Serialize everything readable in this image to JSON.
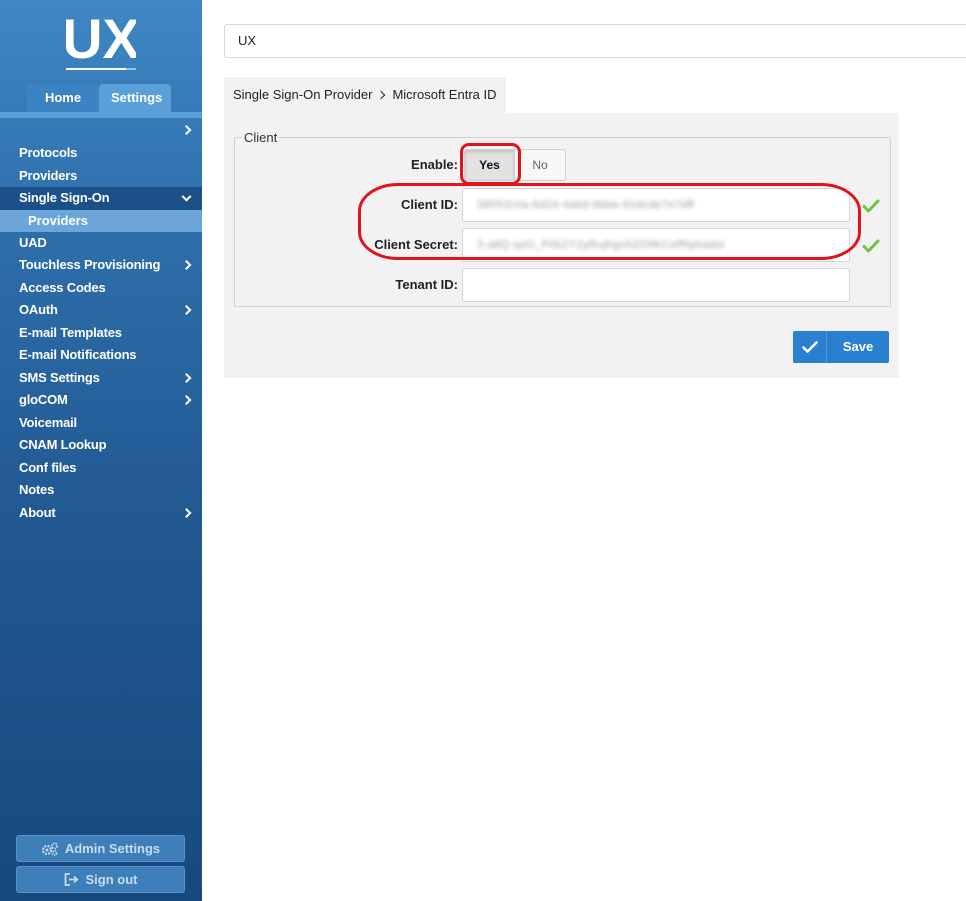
{
  "sidebar": {
    "logo_text": "UX",
    "tabs": [
      {
        "label": "Home"
      },
      {
        "label": "Settings"
      }
    ],
    "items": [
      {
        "label": "Protocols"
      },
      {
        "label": "Providers"
      },
      {
        "label": "Single Sign-On"
      },
      {
        "label": "Providers"
      },
      {
        "label": "UAD"
      },
      {
        "label": "Touchless Provisioning"
      },
      {
        "label": "Access Codes"
      },
      {
        "label": "OAuth"
      },
      {
        "label": "E-mail Templates"
      },
      {
        "label": "E-mail Notifications"
      },
      {
        "label": "SMS Settings"
      },
      {
        "label": "gloCOM"
      },
      {
        "label": "Voicemail"
      },
      {
        "label": "CNAM Lookup"
      },
      {
        "label": "Conf files"
      },
      {
        "label": "Notes"
      },
      {
        "label": "About"
      }
    ],
    "admin_settings": "Admin Settings",
    "sign_out": "Sign out"
  },
  "main": {
    "top_input_value": "UX",
    "breadcrumb": {
      "parent": "Single Sign-On Provider",
      "current": "Microsoft Entra ID"
    },
    "client": {
      "legend": "Client",
      "enable_label": "Enable:",
      "yes_label": "Yes",
      "no_label": "No",
      "enable_value": "Yes",
      "client_id_label": "Client ID:",
      "client_id_value": "38552c0a-6d24-4abd-bbbe-81dcde7e7dff",
      "client_secret_label": "Client Secret:",
      "client_secret_value": "3-a8Q-qxO_P0kZY2yRujhgx5ZO9KCofRphadst",
      "tenant_id_label": "Tenant ID:",
      "tenant_id_value": ""
    },
    "save_label": "Save"
  },
  "colors": {
    "sidebar_top": "#3f87c4",
    "sidebar_bottom": "#17497f",
    "active_item": "#1c5088",
    "sub_item": "#6aa6d9",
    "save_button": "#2980d1",
    "check_green": "#6cc63f",
    "annotation_red": "#e0141d"
  },
  "icons": {
    "expand": "chevron-right-icon",
    "collapse": "chevron-down-icon",
    "admin": "gears-icon",
    "signout": "sign-out-icon",
    "save": "checkmark-icon",
    "valid": "check-icon"
  }
}
